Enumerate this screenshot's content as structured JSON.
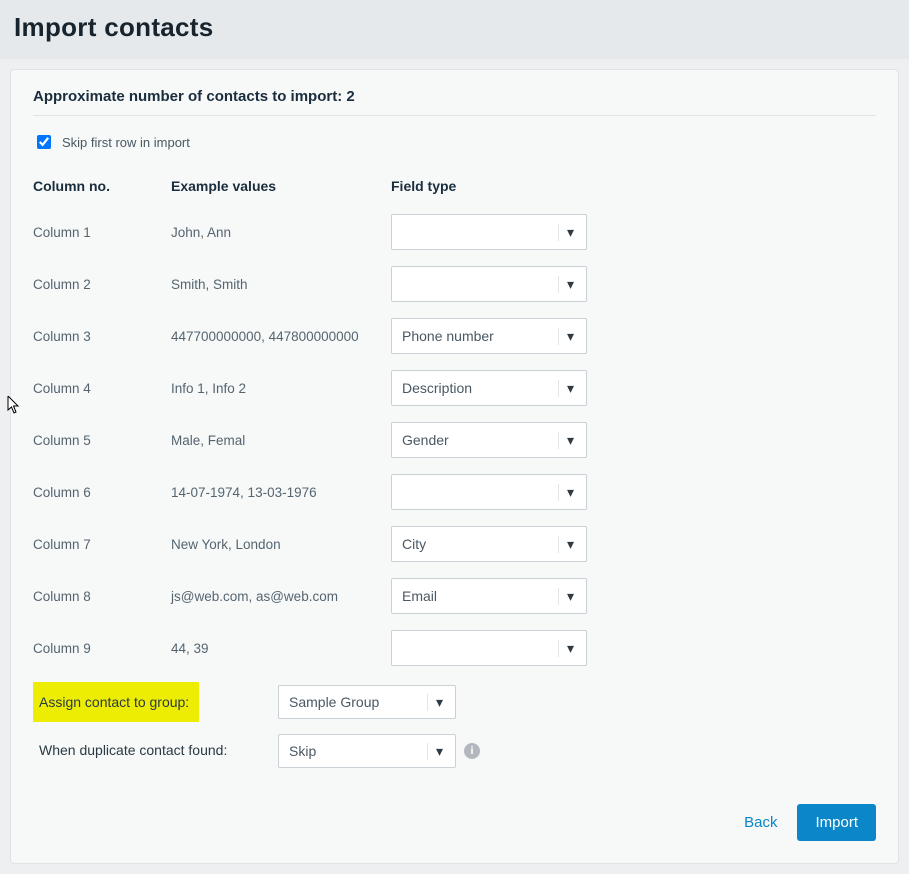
{
  "header": {
    "title": "Import contacts"
  },
  "import": {
    "summary_prefix": "Approximate number of contacts to import: ",
    "count": "2",
    "skip_first_row_label": "Skip first row in import",
    "skip_first_row_checked": true
  },
  "table": {
    "headers": {
      "col_no": "Column no.",
      "example": "Example values",
      "field_type": "Field type"
    },
    "rows": [
      {
        "col": "Column 1",
        "example": "John, Ann",
        "field_type": ""
      },
      {
        "col": "Column 2",
        "example": "Smith, Smith",
        "field_type": ""
      },
      {
        "col": "Column 3",
        "example": "447700000000, 447800000000",
        "field_type": "Phone number"
      },
      {
        "col": "Column 4",
        "example": "Info 1, Info 2",
        "field_type": "Description"
      },
      {
        "col": "Column 5",
        "example": "Male, Femal",
        "field_type": "Gender"
      },
      {
        "col": "Column 6",
        "example": "14-07-1974, 13-03-1976",
        "field_type": ""
      },
      {
        "col": "Column 7",
        "example": "New York, London",
        "field_type": "City"
      },
      {
        "col": "Column 8",
        "example": "js@web.com, as@web.com",
        "field_type": "Email"
      },
      {
        "col": "Column 9",
        "example": "44, 39",
        "field_type": ""
      }
    ]
  },
  "options": {
    "group_label": "Assign contact to group:",
    "group_value": "Sample Group",
    "duplicate_label": "When duplicate contact found:",
    "duplicate_value": "Skip"
  },
  "footer": {
    "back": "Back",
    "import": "Import"
  }
}
